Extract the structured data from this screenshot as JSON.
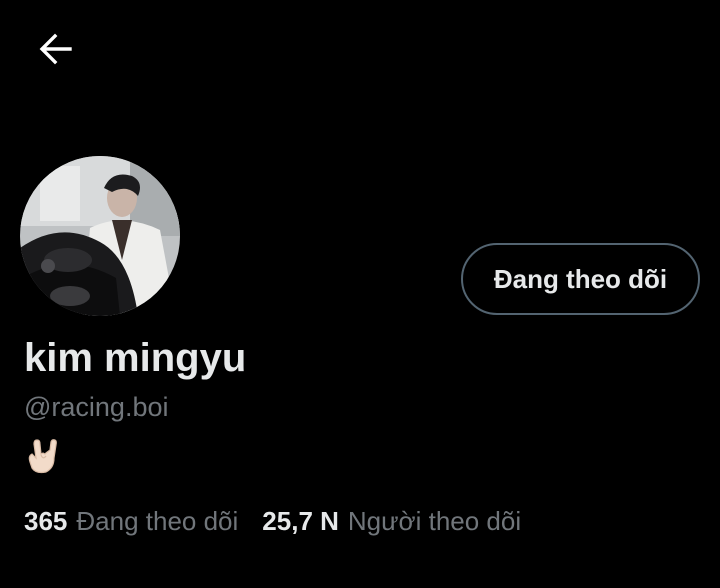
{
  "header": {
    "back_icon": "arrow-left-icon"
  },
  "profile": {
    "display_name": "kim mingyu",
    "handle": "@racing.boi",
    "bio_emoji": "🤟🏻",
    "avatar": "profile-photo"
  },
  "actions": {
    "following_button_label": "Đang theo dõi"
  },
  "stats": {
    "following_count": "365",
    "following_label": "Đang theo dõi",
    "followers_count": "25,7 N",
    "followers_label": "Người theo dõi"
  },
  "colors": {
    "background": "#000000",
    "primary_text": "#e7e9ea",
    "secondary_text": "#71767b",
    "button_border": "#536471"
  }
}
